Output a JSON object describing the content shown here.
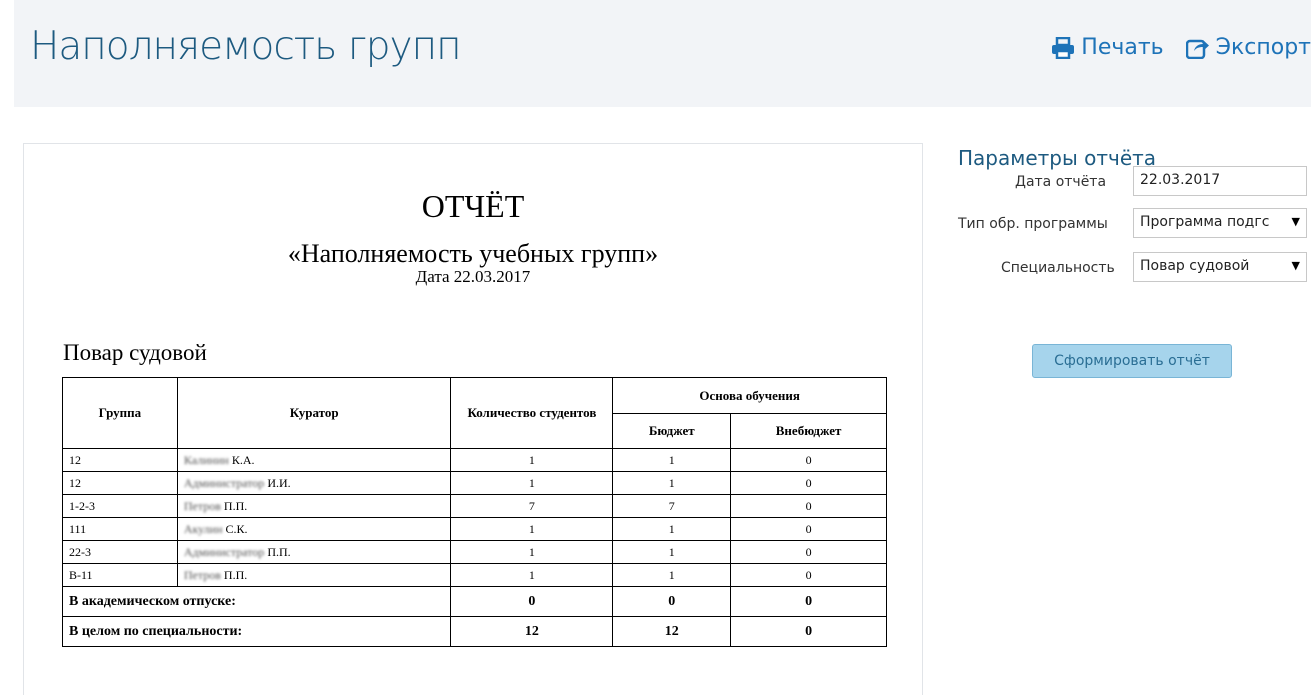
{
  "header": {
    "title": "Наполняемость групп",
    "print_label": "Печать",
    "export_label": "Экспорт"
  },
  "report": {
    "title": "ОТЧЁТ",
    "subtitle": "«Наполняемость учебных групп»",
    "date_line": "Дата 22.03.2017",
    "specialty": "Повар судовой",
    "table": {
      "headers": {
        "group": "Группа",
        "curator": "Куратор",
        "count": "Количество студентов",
        "basis": "Основа обучения",
        "budget": "Бюджет",
        "nonbudget": "Внебюджет"
      },
      "rows": [
        {
          "group": "12",
          "curator_surname": "Калинин",
          "curator_initials": "К.А.",
          "count": "1",
          "budget": "1",
          "nonbudget": "0"
        },
        {
          "group": "12",
          "curator_surname": "Администратор",
          "curator_initials": "И.И.",
          "count": "1",
          "budget": "1",
          "nonbudget": "0"
        },
        {
          "group": "1-2-3",
          "curator_surname": "Петров",
          "curator_initials": "П.П.",
          "count": "7",
          "budget": "7",
          "nonbudget": "0"
        },
        {
          "group": "111",
          "curator_surname": "Акулин",
          "curator_initials": "С.К.",
          "count": "1",
          "budget": "1",
          "nonbudget": "0"
        },
        {
          "group": "22-3",
          "curator_surname": "Администратор",
          "curator_initials": "П.П.",
          "count": "1",
          "budget": "1",
          "nonbudget": "0"
        },
        {
          "group": "В-11",
          "curator_surname": "Петров",
          "curator_initials": "П.П.",
          "count": "1",
          "budget": "1",
          "nonbudget": "0"
        }
      ],
      "academic_leave": {
        "label": "В академическом отпуске:",
        "count": "0",
        "budget": "0",
        "nonbudget": "0"
      },
      "total": {
        "label": "В целом по специальности:",
        "count": "12",
        "budget": "12",
        "nonbudget": "0"
      }
    }
  },
  "params": {
    "title": "Параметры отчёта",
    "date_label": "Дата отчёта",
    "date_value": "22.03.2017",
    "program_label": "Тип обр. программы",
    "program_value": "Программа подгс",
    "specialty_label": "Специальность",
    "specialty_value": "Повар судовой",
    "generate_label": "Сформировать отчёт"
  },
  "colors": {
    "title": "#1d5a80",
    "link": "#1e73b8",
    "button_bg": "#a6d4ec"
  },
  "icons": {
    "print": "printer-icon",
    "export": "share-icon"
  }
}
